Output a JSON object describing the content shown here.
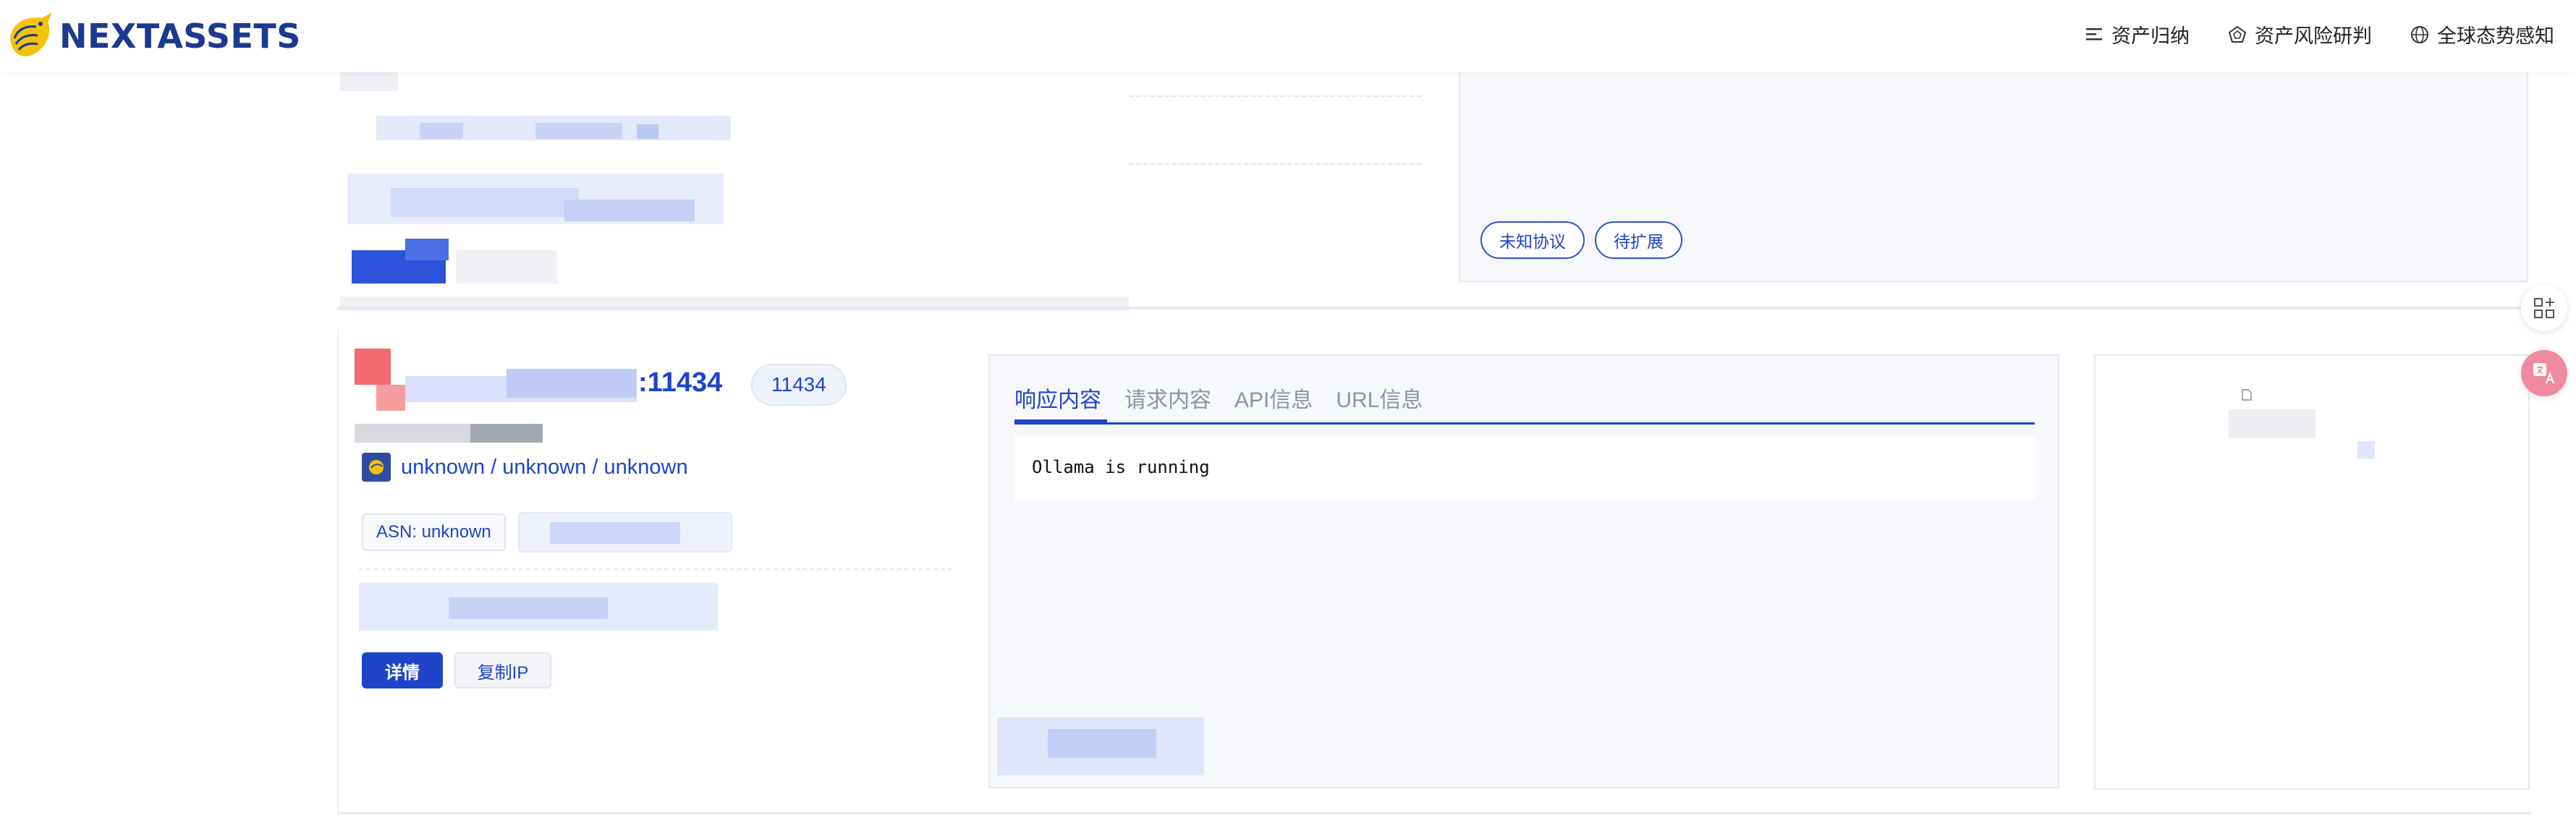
{
  "header": {
    "brand": "NEXTASSETS",
    "nav": [
      {
        "label": "资产归纳",
        "icon": "list-icon"
      },
      {
        "label": "资产风险研判",
        "icon": "risk-pentagon-icon"
      },
      {
        "label": "全球态势感知",
        "icon": "globe-icon"
      }
    ]
  },
  "top_card": {
    "tags": [
      "未知协议",
      "待扩展"
    ]
  },
  "asset": {
    "ip_suffix": ":11434",
    "port": "11434",
    "location": "unknown / unknown / unknown",
    "asn": "ASN: unknown",
    "actions": {
      "detail": "详情",
      "copy_ip": "复制IP"
    }
  },
  "response_panel": {
    "tabs": [
      "响应内容",
      "请求内容",
      "API信息",
      "URL信息"
    ],
    "active_tab": 0,
    "body": "Ollama is running"
  },
  "colors": {
    "brand": "#1b3a8f",
    "accent": "#1d44c9",
    "panel_bg": "#f7f8fc",
    "float_pink": "#f08aa0"
  }
}
